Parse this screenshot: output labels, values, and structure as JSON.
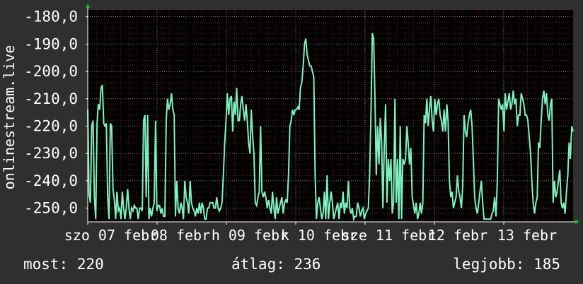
{
  "colors": {
    "background": "#2f2f2f",
    "plot_background": "#000000",
    "line": "#7df2bf",
    "grid_minor": "#5a1818",
    "grid_major": "#7a7a7a",
    "axis": "#ffffff",
    "arrow": "#18c018"
  },
  "chart_data": {
    "type": "line",
    "title": "",
    "xlabel": "",
    "ylabel": "onlinestream.live",
    "ylim": [
      -255.0,
      -177.5
    ],
    "grid": true,
    "yticks": [
      "-180,0",
      "-190,0",
      "-200,0",
      "-210,0",
      "-220,0",
      "-230,0",
      "-240,0",
      "-250,0"
    ],
    "ytick_values": [
      -180,
      -190,
      -200,
      -210,
      -220,
      -230,
      -240,
      -250
    ],
    "xticks": [
      "szo 07 febr",
      "08 febr",
      "h 09 febr",
      "k 10 febr",
      "sze 11 febr",
      "12 febr",
      "13 febr"
    ],
    "series": [
      {
        "name": "",
        "x_start": 0,
        "x_end": 1,
        "values": [
          -214,
          -245,
          -248,
          -220,
          -218,
          -246,
          -254,
          -219,
          -212,
          -214,
          -206,
          -205,
          -219,
          -220,
          -219,
          -246,
          -254,
          -219,
          -220,
          -243,
          -247,
          -254,
          -244,
          -251,
          -250,
          -254,
          -244,
          -250,
          -254,
          -250,
          -243,
          -250,
          -254,
          -250,
          -251,
          -249,
          -250,
          -250,
          -254,
          -250,
          -250,
          -251,
          -218,
          -216,
          -246,
          -216,
          -254,
          -250,
          -253,
          -250,
          -248,
          -218,
          -251,
          -249,
          -249,
          -252,
          -250,
          -253,
          -253,
          -218,
          -210,
          -214,
          -212,
          -208,
          -214,
          -216,
          -253,
          -240,
          -250,
          -252,
          -248,
          -250,
          -254,
          -240,
          -246,
          -248,
          -252,
          -240,
          -248,
          -250,
          -251,
          -253,
          -250,
          -252,
          -248,
          -252,
          -248,
          -250,
          -254,
          -254,
          -250,
          -250,
          -248,
          -248,
          -248,
          -250,
          -250,
          -246,
          -250,
          -251,
          -250,
          -248,
          -238,
          -226,
          -218,
          -208,
          -216,
          -210,
          -209,
          -222,
          -211,
          -216,
          -206,
          -218,
          -218,
          -212,
          -209,
          -214,
          -218,
          -212,
          -218,
          -226,
          -230,
          -214,
          -224,
          -230,
          -248,
          -249,
          -246,
          -244,
          -220,
          -244,
          -246,
          -244,
          -246,
          -250,
          -247,
          -250,
          -252,
          -244,
          -250,
          -254,
          -246,
          -252,
          -250,
          -248,
          -246,
          -252,
          -248,
          -247,
          -248,
          -238,
          -220,
          -218,
          -214,
          -216,
          -214,
          -214,
          -213,
          -214,
          -206,
          -204,
          -198,
          -190,
          -188,
          -194,
          -196,
          -198,
          -198,
          -200,
          -202,
          -238,
          -254,
          -248,
          -246,
          -250,
          -254,
          -252,
          -244,
          -254,
          -238,
          -254,
          -248,
          -244,
          -248,
          -254,
          -252,
          -250,
          -248,
          -254,
          -248,
          -250,
          -244,
          -252,
          -248,
          -250,
          -240,
          -250,
          -252,
          -250,
          -254,
          -253,
          -253,
          -248,
          -250,
          -253,
          -251,
          -250,
          -254,
          -252,
          -251,
          -250,
          -238,
          -216,
          -186,
          -188,
          -210,
          -238,
          -220,
          -234,
          -217,
          -226,
          -250,
          -228,
          -212,
          -248,
          -232,
          -240,
          -232,
          -252,
          -248,
          -210,
          -248,
          -232,
          -254,
          -220,
          -254,
          -232,
          -234,
          -232,
          -220,
          -226,
          -234,
          -228,
          -246,
          -249,
          -252,
          -248,
          -254,
          -252,
          -248,
          -252,
          -248,
          -216,
          -219,
          -210,
          -220,
          -214,
          -209,
          -218,
          -222,
          -210,
          -216,
          -212,
          -210,
          -216,
          -218,
          -222,
          -214,
          -222,
          -212,
          -218,
          -240,
          -246,
          -244,
          -250,
          -248,
          -246,
          -238,
          -244,
          -246,
          -250,
          -242,
          -216,
          -222,
          -224,
          -219,
          -216,
          -214,
          -220,
          -232,
          -246,
          -250,
          -252,
          -248,
          -244,
          -240,
          -248,
          -254,
          -254,
          -254,
          -254,
          -254,
          -254,
          -252,
          -251,
          -246,
          -253,
          -240,
          -210,
          -212,
          -214,
          -212,
          -222,
          -208,
          -214,
          -211,
          -208,
          -214,
          -212,
          -207,
          -212,
          -210,
          -220,
          -216,
          -216,
          -208,
          -210,
          -212,
          -216,
          -216,
          -218,
          -224,
          -230,
          -240,
          -248,
          -252,
          -248,
          -246,
          -226,
          -228,
          -218,
          -210,
          -207,
          -212,
          -208,
          -216,
          -218,
          -212,
          -210,
          -248,
          -240,
          -246,
          -244,
          -240,
          -236,
          -248,
          -250,
          -248,
          -252,
          -244,
          -238,
          -226,
          -232,
          -220,
          -222
        ]
      }
    ]
  },
  "stats": {
    "current": "most: 220",
    "average": "átlag: 236",
    "max": "legjobb: 185"
  }
}
